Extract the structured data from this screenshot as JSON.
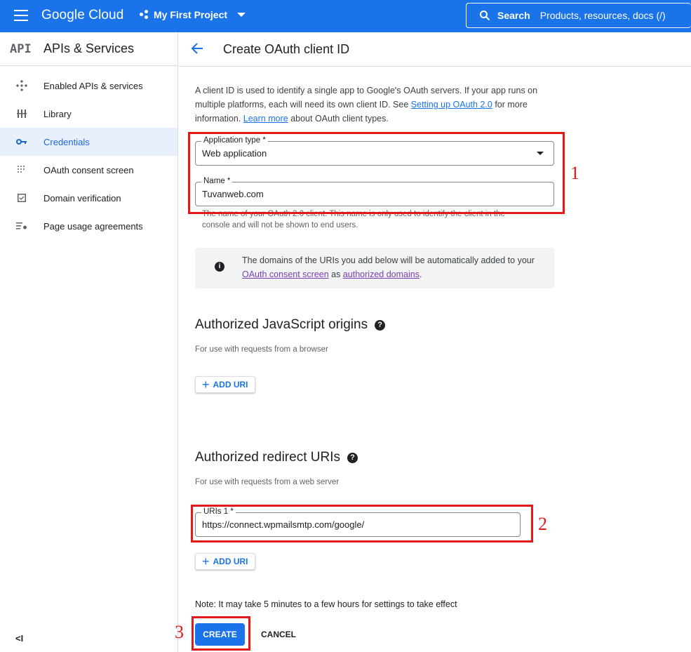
{
  "topbar": {
    "brand": "Google Cloud",
    "project": "My First Project",
    "search_label": "Search",
    "search_placeholder": "Products, resources, docs (/)"
  },
  "sidebar": {
    "logo": "API",
    "title": "APIs & Services",
    "items": [
      {
        "label": "Enabled APIs & services",
        "icon": "diamond-arrows-icon",
        "active": false
      },
      {
        "label": "Library",
        "icon": "library-grid-icon",
        "active": false
      },
      {
        "label": "Credentials",
        "icon": "key-icon",
        "active": true
      },
      {
        "label": "OAuth consent screen",
        "icon": "dotted-grid-icon",
        "active": false
      },
      {
        "label": "Domain verification",
        "icon": "checkbox-icon",
        "active": false
      },
      {
        "label": "Page usage agreements",
        "icon": "settings-list-icon",
        "active": false
      }
    ],
    "collapse_label": "<I"
  },
  "header": {
    "title": "Create OAuth client ID"
  },
  "form": {
    "intro_1": "A client ID is used to identify a single app to Google's OAuth servers. If your app runs on multiple platforms, each will need its own client ID. See ",
    "intro_link_1": "Setting up OAuth 2.0",
    "intro_2": " for more information. ",
    "intro_link_2": "Learn more",
    "intro_3": " about OAuth client types.",
    "app_type_label": "Application type *",
    "app_type_value": "Web application",
    "name_label": "Name *",
    "name_value": "Tuvanweb.com",
    "name_hint": "The name of your OAuth 2.0 client. This name is only used to identify the client in the console and will not be shown to end users.",
    "info_1": "The domains of the URIs you add below will be automatically added to your ",
    "info_link_1": "OAuth consent screen",
    "info_2": " as ",
    "info_link_2": "authorized domains",
    "info_3": "."
  },
  "js_origins": {
    "title": "Authorized JavaScript origins",
    "subtitle": "For use with requests from a browser",
    "add_label": "ADD URI"
  },
  "redirect_uris": {
    "title": "Authorized redirect URIs",
    "subtitle": "For use with requests from a web server",
    "uri_label": "URIs 1 *",
    "uri_value": "https://connect.wpmailsmtp.com/google/",
    "add_label": "ADD URI"
  },
  "footer": {
    "note": "Note: It may take 5 minutes to a few hours for settings to take effect",
    "create_label": "CREATE",
    "cancel_label": "CANCEL"
  },
  "annotations": {
    "label_1": "1",
    "label_2": "2",
    "label_3": "3",
    "color": "#e11919"
  },
  "colors": {
    "primary": "#1a73e8",
    "active_bg": "#e8f0fe"
  }
}
